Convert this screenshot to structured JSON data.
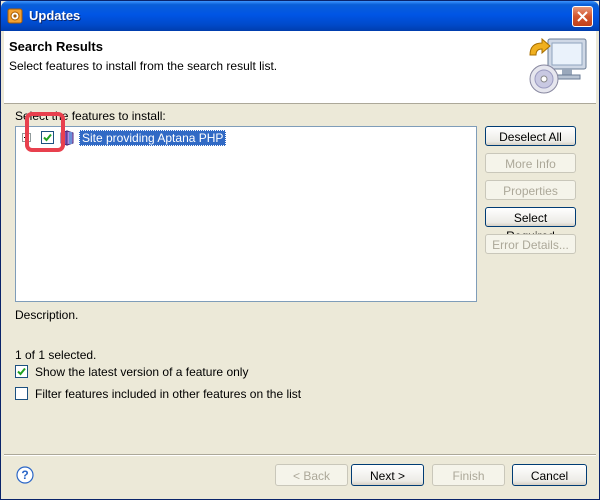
{
  "window": {
    "title": "Updates",
    "close_label": ""
  },
  "header": {
    "title": "Search Results",
    "description": "Select features to install from the search result list."
  },
  "tree": {
    "label": "Select the features to install:",
    "items": [
      {
        "label": "Site providing Aptana PHP",
        "checked": true,
        "expanded": false
      }
    ]
  },
  "side_buttons": {
    "deselect_all": "Deselect All",
    "more_info": "More Info",
    "properties": "Properties",
    "select_required": "Select Required",
    "error_details": "Error Details..."
  },
  "description_label": "Description.",
  "selected_count": "1 of 1 selected.",
  "options": {
    "show_latest": {
      "label": "Show the latest version of a feature only",
      "checked": true
    },
    "filter_included": {
      "label": "Filter features included in other features on the list",
      "checked": false
    }
  },
  "footer": {
    "back": "< Back",
    "next": "Next >",
    "finish": "Finish",
    "cancel": "Cancel"
  },
  "colors": {
    "titlebar": "#0055e5",
    "selection": "#316ac5",
    "highlight_box": "#e8404e",
    "dialog_bg": "#ece9d8"
  },
  "icons": [
    "gear-icon",
    "close-icon",
    "install-wizard-icon",
    "site-icon",
    "help-icon",
    "checkmark-icon"
  ]
}
